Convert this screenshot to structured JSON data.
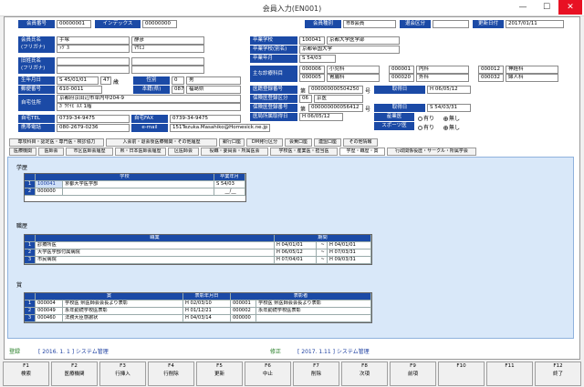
{
  "window": {
    "title": "会員入力(EN001)",
    "minimize": "—",
    "maximize": "☐",
    "close": "✕"
  },
  "header": {
    "kaiin_no_label": "会員番号",
    "kaiin_no": "00000001",
    "index_label": "インデックス",
    "index": "00000000",
    "shubetsu_label": "会員種別",
    "shubetsu": "市B会員",
    "taikai_label": "退会区分",
    "taikai": "",
    "koshin_label": "更新日付",
    "koshin": "2017/01/11"
  },
  "person": {
    "name_label": "会員氏名\n(フリガナ)",
    "sei": "手塚",
    "mei": "静彦",
    "sei_kana": "ﾃﾂﾞｶ",
    "mei_kana": "ﾏｻﾋｺ",
    "old_name_label": "旧姓氏名\n(フリガナ)",
    "birth_label": "生年月日",
    "birth": "S 45/01/01",
    "age": "47",
    "age_unit": "歳",
    "sex_label": "性別",
    "sex_code": "0",
    "sex": "男",
    "zip_label": "郵便番号",
    "zip": "610-0011",
    "pref_label": "本籍(県)",
    "pref_code": "087",
    "pref": "福島県",
    "addr_label": "自宅住所",
    "addr1": "京都府京田辺市草内中204-9",
    "addr2": "ｶﾞﾜｹｲﾋﾞﾙｽ 1階",
    "tel_label": "自宅TEL",
    "tel": "0739-34-9475",
    "fax_label": "自宅FAX",
    "fax": "0739-34-9475",
    "mobile_label": "携帯電話",
    "mobile": "080-2679-0236",
    "email_label": "e-mail",
    "email": "151Tezuka.Masahiko@Homesick.ne.jp"
  },
  "school": {
    "gakko_label": "卒業学校",
    "gakko_code": "100041",
    "gakko": "京都大学医学部",
    "gakkou_label": "卒業学校(別名)",
    "gakkou": "京都帝国大学",
    "nen_label": "卒業年月",
    "nen": "S 54/03",
    "kamoku_label": "主な診療科目",
    "kamoku": [
      {
        "code": "000006",
        "name": "小児科"
      },
      {
        "code": "000001",
        "name": "内科"
      },
      {
        "code": "000012",
        "name": "神経科"
      },
      {
        "code": "000005",
        "name": "胃腸科"
      },
      {
        "code": "000020",
        "name": "外科"
      },
      {
        "code": "000032",
        "name": "婦人科"
      }
    ],
    "touroku_label": "医籍登録番号",
    "touroku_prefix": "第",
    "touroku_no": "000000000504250",
    "touroku_suffix": "号",
    "touroku_date_label": "取得日",
    "touroku_date": "H 06/05/12",
    "hoken_label": "保険医登録区分",
    "hoken_code": "06",
    "hoken": "京医",
    "hokenno_label": "保険医登録番号",
    "hokenno_prefix": "第",
    "hokenno": "000000000056412",
    "hokenno_suffix": "号",
    "hokenno_date_label": "取得日",
    "hokenno_date": "S 54/03/31",
    "ikyoku_label": "医局所属取得日",
    "ikyoku": "H 06/05/12",
    "sangyo_label": "産業医",
    "sports_label": "スポーツ医",
    "ari": "有り",
    "nashi": "無し"
  },
  "tabs_row1": [
    "専攻科目・認定医・専門医・検診協力",
    "入会前・退会後医療機関・その他履歴",
    "銀行口座",
    "DM発行区分",
    "会費口座",
    "連盟口座",
    "その他情報"
  ],
  "tabs_row2": [
    "医療機関",
    "医師会",
    "市区医師会履歴",
    "県・日本医師会履歴",
    "区医師会",
    "役職・委員会・所属医会",
    "学校医・産業医・担当医",
    "学歴・職歴・賞",
    "行政関係役歴・サークル・所属学会"
  ],
  "gakureki": {
    "title": "学歴",
    "col_school": "学校",
    "col_date": "卒業年月",
    "rows": [
      {
        "n": "1",
        "code": "100041",
        "name": "京都大学医学部",
        "date": "S 54/03"
      },
      {
        "n": "2",
        "code": "000000",
        "name": "",
        "date": "__/__"
      }
    ]
  },
  "shokureki": {
    "title": "職歴",
    "col_name": "職業",
    "col_period": "期間",
    "rows": [
      {
        "n": "1",
        "name": "診療所医",
        "from": "H 04/01/01",
        "to": "H 04/01/01"
      },
      {
        "n": "2",
        "name": "大学医学部付属病院",
        "from": "H 06/05/12",
        "to": "H 07/03/31"
      },
      {
        "n": "3",
        "name": "市民病院",
        "from": "H 07/04/01",
        "to": "H 09/03/31"
      }
    ],
    "tilde": "~"
  },
  "sho": {
    "title": "賞",
    "col_sho": "賞",
    "col_date": "表彰年月日",
    "col_hyoshosha": "表彰者",
    "rows": [
      {
        "n": "1",
        "code": "000004",
        "name": "学校医 県医師会会長より表彰",
        "date": "H 02/03/10",
        "hcode": "000001",
        "hname": "学校医 県医師会会長より表彰"
      },
      {
        "n": "2",
        "code": "000049",
        "name": "永年勤続学校医表彰",
        "date": "H 01/12/21",
        "hcode": "000002",
        "hname": "永年勤続学校医表彰"
      },
      {
        "n": "3",
        "code": "000460",
        "name": "法務大臣感謝状",
        "date": "H 04/03/14",
        "hcode": "000000",
        "hname": ""
      }
    ]
  },
  "footer": {
    "touroku_label": "登録",
    "touroku_value": "[ 2016. 1. 1 ] システム管理",
    "shusei_label": "修正",
    "shusei_value": "[ 2017. 1.11 ] システム管理"
  },
  "fkeys": [
    {
      "k": "F1",
      "l": "検索"
    },
    {
      "k": "F2",
      "l": "医療機関"
    },
    {
      "k": "F3",
      "l": "行挿入"
    },
    {
      "k": "F4",
      "l": "行削除"
    },
    {
      "k": "F5",
      "l": "更新"
    },
    {
      "k": "F6",
      "l": "中止"
    },
    {
      "k": "F7",
      "l": "削除"
    },
    {
      "k": "F8",
      "l": "次項"
    },
    {
      "k": "F9",
      "l": "前項"
    },
    {
      "k": "F10",
      "l": ""
    },
    {
      "k": "F11",
      "l": ""
    },
    {
      "k": "F12",
      "l": "終了"
    }
  ]
}
